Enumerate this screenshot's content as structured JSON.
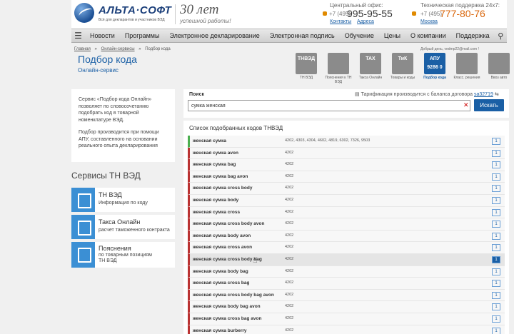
{
  "header": {
    "logo_text": "АЛЬТА·СОФТ",
    "logo_sub": "Всё для декларантов и участников ВЭД",
    "anniversary": "30 лет",
    "anniversary_sub": "успешной работы!",
    "office_label": "Центральный офис:",
    "office_phone_prefix": "+7 (495)",
    "office_phone": "995-95-55",
    "office_link_contacts": "Контакты",
    "office_link_addresses": "Адреса",
    "support_label": "Техническая поддержка 24х7:",
    "support_phone_prefix": "+7 (495)",
    "support_phone": "777-80-76",
    "support_city": "Москва"
  },
  "nav": {
    "items": [
      "Новости",
      "Программы",
      "Электронное декларирование",
      "Электронная подпись",
      "Обучение",
      "Цены",
      "О компании",
      "Поддержка"
    ]
  },
  "breadcrumb": [
    "Главная",
    "»",
    "Онлайн-сервисы",
    "»",
    "Подбор кода"
  ],
  "page": {
    "title": "Подбор кода",
    "subtitle": "Онлайн-сервис",
    "greeting": "Добрый день, vedmp22@mail.com !"
  },
  "tiles": [
    {
      "icon_text": "ТНВЭД",
      "label": "ТН ВЭД",
      "icon": "tnved-icon"
    },
    {
      "icon_text": "",
      "label": "Пояснения к ТН ВЭД",
      "icon": "document-icon"
    },
    {
      "icon_text": "TAX",
      "label": "Такса Онлайн",
      "icon": "calculator-icon"
    },
    {
      "icon_text": "ТиК",
      "label": "Товары и коды",
      "icon": "goods-icon"
    },
    {
      "icon_text": "АПУ 9286 0",
      "label": "Подбор кода",
      "icon": "apu-icon"
    },
    {
      "icon_text": "",
      "label": "Класс. решения",
      "icon": "clipboard-icon"
    },
    {
      "icon_text": "",
      "label": "Ввоз авто",
      "icon": "car-icon"
    }
  ],
  "info": {
    "p1": "Сервис «Подбор кода Онлайн» позволяет по словосочетанию подобрать код в товарной номенклатуре ВЭД.",
    "p2": "Подбор производится при помощи АПУ, составленного на основании реального опыта декларирования"
  },
  "services": {
    "title": "Сервисы ТН ВЭД",
    "items": [
      {
        "title": "ТН ВЭД",
        "desc": "Информация по коду"
      },
      {
        "title": "Такса Онлайн",
        "desc": "расчет таможенного контракта"
      },
      {
        "title": "Пояснения",
        "desc": "по товарным позициям ТН ВЭД"
      }
    ]
  },
  "search": {
    "label": "Поиск",
    "note": "Тарификация производится с баланса договора",
    "contract": "sa32719",
    "value": "сумка женская",
    "button": "Искать"
  },
  "results": {
    "title": "Список подобранных кодов ТНВЭД",
    "rows": [
      {
        "name": "женская сумка",
        "codes": "4202, 4303, 4304, 4602, 4819, 6302, 7326, 9503",
        "count": "1"
      },
      {
        "name": "женская сумка avon",
        "codes": "4202",
        "count": "1"
      },
      {
        "name": "женская сумка bag",
        "codes": "4202",
        "count": "1"
      },
      {
        "name": "женская сумка bag avon",
        "codes": "4202",
        "count": "1"
      },
      {
        "name": "женская сумка cross body",
        "codes": "4202",
        "count": "1"
      },
      {
        "name": "женская сумка body",
        "codes": "4202",
        "count": "1"
      },
      {
        "name": "женская сумка cross",
        "codes": "4202",
        "count": "1"
      },
      {
        "name": "женская сумка cross body avon",
        "codes": "4202",
        "count": "1"
      },
      {
        "name": "женская сумка body avon",
        "codes": "4202",
        "count": "1"
      },
      {
        "name": "женская сумка cross avon",
        "codes": "4202",
        "count": "1"
      },
      {
        "name": "женская сумка cross body bag",
        "codes": "4202",
        "count": "1"
      },
      {
        "name": "женская сумка body bag",
        "codes": "4202",
        "count": "1"
      },
      {
        "name": "женская сумка cross bag",
        "codes": "4202",
        "count": "1"
      },
      {
        "name": "женская сумка cross body bag avon",
        "codes": "4202",
        "count": "1"
      },
      {
        "name": "женская сумка body bag avon",
        "codes": "4202",
        "count": "1"
      },
      {
        "name": "женская сумка cross bag avon",
        "codes": "4202",
        "count": "1"
      },
      {
        "name": "женская сумка burberry",
        "codes": "4202",
        "count": "1"
      }
    ]
  }
}
